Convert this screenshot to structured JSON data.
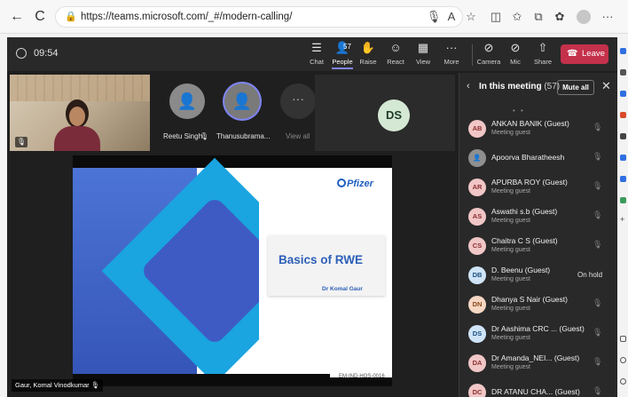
{
  "browser": {
    "url": "https://teams.microsoft.com/_#/modern-calling/",
    "nav": {
      "back": "←",
      "refresh": "C"
    },
    "toolbar_icons": [
      "mic-icon",
      "read-aloud-icon",
      "favorite-icon",
      "split-screen-icon",
      "favorites-icon",
      "collections-icon",
      "extensions-icon",
      "profile-icon",
      "more-icon"
    ],
    "aa_label": "A"
  },
  "meeting": {
    "timer": "09:54",
    "controls": [
      {
        "id": "chat",
        "label": "Chat",
        "glyph": "☰"
      },
      {
        "id": "people",
        "label": "People",
        "glyph": "👤",
        "count": "57",
        "active": true
      },
      {
        "id": "raise",
        "label": "Raise",
        "glyph": "✋"
      },
      {
        "id": "react",
        "label": "React",
        "glyph": "☺"
      },
      {
        "id": "view",
        "label": "View",
        "glyph": "▦"
      },
      {
        "id": "more",
        "label": "More",
        "glyph": "···"
      },
      {
        "id": "camera",
        "label": "Camera",
        "glyph": "⊘"
      },
      {
        "id": "mic",
        "label": "Mic",
        "glyph": "⊘"
      },
      {
        "id": "share",
        "label": "Share",
        "glyph": "⇧"
      }
    ],
    "leave_label": "Leave",
    "tiles": {
      "participants": [
        {
          "name": "Reetu Singh"
        },
        {
          "name": "Thanusubrama..."
        }
      ],
      "view_all": "View all",
      "ds_initials": "DS"
    },
    "slide": {
      "brand": "Pfizer",
      "title": "Basics of RWE",
      "author": "Dr Komal Gaur",
      "code": "EM-IND-HOS-0016"
    },
    "presenter_name": "Gaur, Komal Vinodkumar"
  },
  "panel": {
    "title": "In this meeting",
    "count": "(57)",
    "mute_all": "Mute all",
    "people": [
      {
        "initials": "AB",
        "name": "ANKAN BANIK (Guest)",
        "sub": "Meeting guest",
        "bg": "#f1c6c6",
        "fg": "#8a2f2f",
        "status": ""
      },
      {
        "initials": "",
        "name": "Apoorva Bharatheesh",
        "sub": "",
        "bg": "#8f8f8f",
        "fg": "#ffffff",
        "status": ""
      },
      {
        "initials": "AR",
        "name": "APURBA ROY (Guest)",
        "sub": "Meeting guest",
        "bg": "#f1c6c6",
        "fg": "#8a2f2f",
        "status": ""
      },
      {
        "initials": "AS",
        "name": "Aswathi s.b (Guest)",
        "sub": "Meeting guest",
        "bg": "#f1c6c6",
        "fg": "#8a2f2f",
        "status": ""
      },
      {
        "initials": "CS",
        "name": "Chaitra C S (Guest)",
        "sub": "Meeting guest",
        "bg": "#f1c6c6",
        "fg": "#8a2f2f",
        "status": ""
      },
      {
        "initials": "DB",
        "name": "D. Beenu (Guest)",
        "sub": "Meeting guest",
        "bg": "#cfe4f7",
        "fg": "#1e4f80",
        "status": "On hold"
      },
      {
        "initials": "DN",
        "name": "Dhanya S Nair (Guest)",
        "sub": "Meeting guest",
        "bg": "#f6d7c3",
        "fg": "#8a4a1f",
        "status": ""
      },
      {
        "initials": "DS",
        "name": "Dr Aashima CRC ... (Guest)",
        "sub": "Meeting guest",
        "bg": "#cfe4f7",
        "fg": "#1e4f80",
        "status": ""
      },
      {
        "initials": "DA",
        "name": "Dr Amanda_NEI... (Guest)",
        "sub": "Meeting guest",
        "bg": "#f1c6c6",
        "fg": "#8a2f2f",
        "status": ""
      },
      {
        "initials": "DC",
        "name": "DR ATANU CHA... (Guest)",
        "sub": "",
        "bg": "#f1c6c6",
        "fg": "#8a2f2f",
        "status": ""
      }
    ]
  }
}
